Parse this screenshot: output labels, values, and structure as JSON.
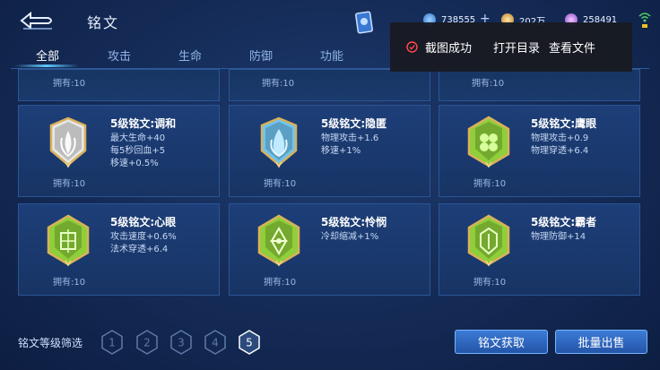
{
  "header": {
    "title": "铭文",
    "currencies": [
      {
        "name": "coupon",
        "value": "738555"
      },
      {
        "name": "gold",
        "value": "202万"
      },
      {
        "name": "crystal",
        "value": "258491"
      }
    ]
  },
  "tabs": [
    {
      "label": "全部",
      "active": true
    },
    {
      "label": "攻击",
      "active": false
    },
    {
      "label": "生命",
      "active": false
    },
    {
      "label": "防御",
      "active": false
    },
    {
      "label": "功能",
      "active": false
    }
  ],
  "toast": {
    "message": "截图成功",
    "open_label": "打开目录",
    "view_label": "查看文件"
  },
  "top_row": [
    {
      "owned": "拥有:10"
    },
    {
      "owned": "拥有:10"
    },
    {
      "owned": "拥有:10"
    }
  ],
  "runes": [
    {
      "name": "5级铭文:调和",
      "stats": [
        "最大生命+40",
        "每5秒回血+5",
        "移速+0.5%"
      ],
      "owned": "拥有:10",
      "color": "#e6e6e6"
    },
    {
      "name": "5级铭文:隐匿",
      "stats": [
        "物理攻击+1.6",
        "移速+1%"
      ],
      "owned": "拥有:10",
      "color": "#6fc4ef"
    },
    {
      "name": "5级铭文:鹰眼",
      "stats": [
        "物理攻击+0.9",
        "物理穿透+6.4"
      ],
      "owned": "拥有:10",
      "color": "#8ecf3a"
    },
    {
      "name": "5级铭文:心眼",
      "stats": [
        "攻击速度+0.6%",
        "法术穿透+6.4"
      ],
      "owned": "拥有:10",
      "color": "#8ecf3a"
    },
    {
      "name": "5级铭文:怜悯",
      "stats": [
        "冷却缩减+1%"
      ],
      "owned": "拥有:10",
      "color": "#8ecf3a"
    },
    {
      "name": "5级铭文:霸者",
      "stats": [
        "物理防御+14"
      ],
      "owned": "拥有:10",
      "color": "#8ecf3a"
    }
  ],
  "filter": {
    "label": "铭文等级筛选",
    "levels": [
      "1",
      "2",
      "3",
      "4",
      "5"
    ],
    "selected": "5"
  },
  "buttons": {
    "get_label": "铭文获取",
    "sell_label": "批量出售"
  }
}
